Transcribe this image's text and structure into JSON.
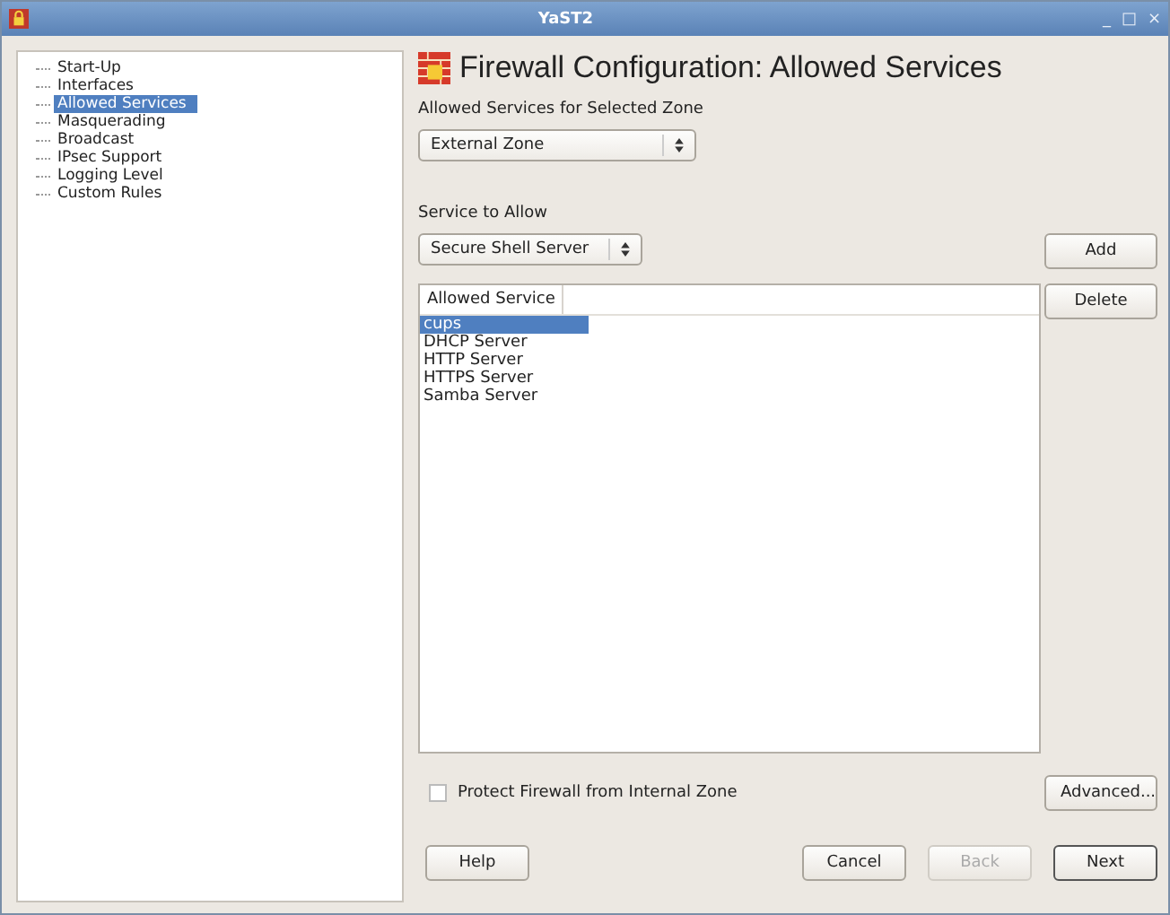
{
  "window": {
    "title": "YaST2",
    "controls": [
      "_",
      "□",
      "×"
    ]
  },
  "sidebar": {
    "items": [
      {
        "label": "Start-Up",
        "selected": false
      },
      {
        "label": "Interfaces",
        "selected": false
      },
      {
        "label": "Allowed Services",
        "selected": true
      },
      {
        "label": "Masquerading",
        "selected": false
      },
      {
        "label": "Broadcast",
        "selected": false
      },
      {
        "label": "IPsec Support",
        "selected": false
      },
      {
        "label": "Logging Level",
        "selected": false
      },
      {
        "label": "Custom Rules",
        "selected": false
      }
    ]
  },
  "heading": "Firewall Configuration: Allowed Services",
  "zone": {
    "label": "Allowed Services for Selected Zone",
    "value": "External Zone"
  },
  "service": {
    "label": "Service to Allow",
    "value": "Secure Shell Server"
  },
  "side_buttons": [
    {
      "label": "Add"
    },
    {
      "label": "Delete"
    }
  ],
  "table": {
    "columns": [
      "Allowed Service"
    ],
    "rows": [
      {
        "cells": [
          "cups"
        ],
        "selected": true
      },
      {
        "cells": [
          "DHCP Server"
        ],
        "selected": false
      },
      {
        "cells": [
          "HTTP Server"
        ],
        "selected": false
      },
      {
        "cells": [
          "HTTPS Server"
        ],
        "selected": false
      },
      {
        "cells": [
          "Samba Server"
        ],
        "selected": false
      }
    ]
  },
  "protect": {
    "label": "Protect Firewall from Internal Zone",
    "checked": false
  },
  "advanced_button": "Advanced...",
  "buttons": [
    {
      "label": "Help",
      "disabled": false,
      "default": false
    },
    {
      "label": "Cancel",
      "disabled": false,
      "default": false
    },
    {
      "label": "Back",
      "disabled": true,
      "default": false
    },
    {
      "label": "Next",
      "disabled": false,
      "default": true
    }
  ]
}
